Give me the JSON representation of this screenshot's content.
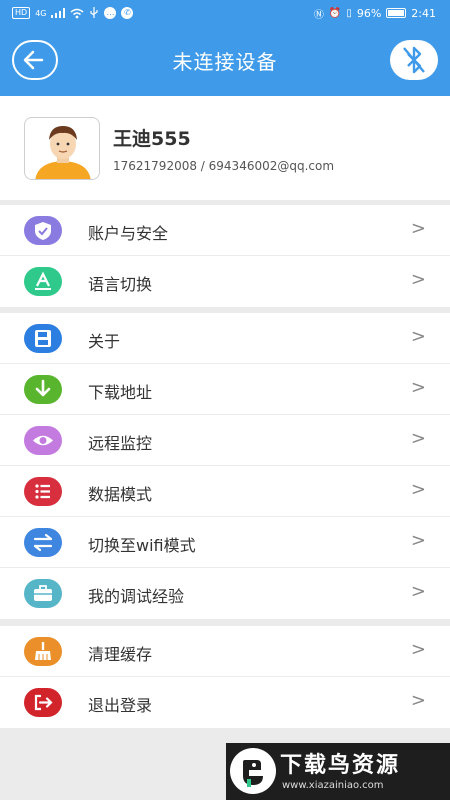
{
  "status_bar": {
    "network_label": "HD",
    "signal_label": "4G",
    "battery_text": "96%",
    "battery_level": 0.96,
    "time": "2:41"
  },
  "header": {
    "title": "未连接设备",
    "back_icon": "back-arrow-icon",
    "bluetooth_icon": "bluetooth-disabled-icon",
    "color": "#3f9be9"
  },
  "profile": {
    "name": "王迪555",
    "contact": "17621792008 / 694346002@qq.com"
  },
  "groups": [
    [
      {
        "label": "账户与安全",
        "icon": "shield-icon",
        "color": "#8a7be0"
      },
      {
        "label": "语言切换",
        "icon": "language-icon",
        "color": "#2fc98b"
      }
    ],
    [
      {
        "label": "关于",
        "icon": "floppy-icon",
        "color": "#2c7ee0"
      },
      {
        "label": "下载地址",
        "icon": "download-icon",
        "color": "#5ab52e"
      },
      {
        "label": "远程监控",
        "icon": "eye-icon",
        "color": "#c47be0"
      },
      {
        "label": "数据模式",
        "icon": "list-icon",
        "color": "#d72f3e"
      },
      {
        "label": "切换至wifi模式",
        "icon": "switch-icon",
        "color": "#3f86e0"
      },
      {
        "label": "我的调试经验",
        "icon": "briefcase-icon",
        "color": "#57b5c8"
      }
    ],
    [
      {
        "label": "清理缓存",
        "icon": "broom-icon",
        "color": "#ea8f29"
      },
      {
        "label": "退出登录",
        "icon": "logout-icon",
        "color": "#d2242b"
      }
    ]
  ],
  "chevron": ">",
  "watermark": {
    "title": "下载鸟资源",
    "url": "www.xiazainiao.com"
  }
}
